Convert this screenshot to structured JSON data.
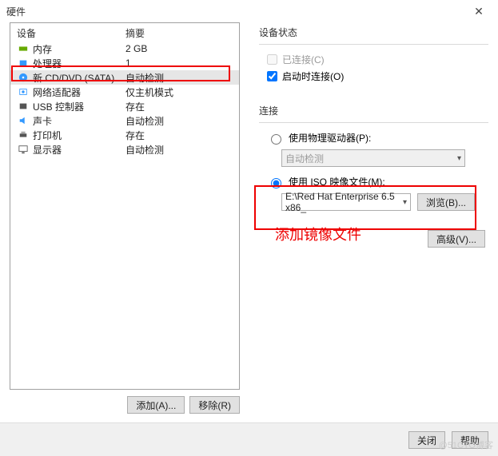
{
  "title": "硬件",
  "columns": {
    "device": "设备",
    "summary": "摘要"
  },
  "devices": [
    {
      "name": "内存",
      "summary": "2 GB",
      "icon": "memory"
    },
    {
      "name": "处理器",
      "summary": "1",
      "icon": "cpu"
    },
    {
      "name": "新 CD/DVD (SATA)",
      "summary": "自动检测",
      "icon": "disc",
      "selected": true
    },
    {
      "name": "网络适配器",
      "summary": "仅主机模式",
      "icon": "net"
    },
    {
      "name": "USB 控制器",
      "summary": "存在",
      "icon": "usb"
    },
    {
      "name": "声卡",
      "summary": "自动检测",
      "icon": "sound"
    },
    {
      "name": "打印机",
      "summary": "存在",
      "icon": "printer"
    },
    {
      "name": "显示器",
      "summary": "自动检测",
      "icon": "display"
    }
  ],
  "buttons": {
    "add": "添加(A)...",
    "remove": "移除(R)",
    "browse": "浏览(B)...",
    "advanced": "高级(V)...",
    "close": "关闭",
    "help": "帮助"
  },
  "status": {
    "title": "设备状态",
    "connected": "已连接(C)",
    "connect_on_start": "启动时连接(O)"
  },
  "connection": {
    "title": "连接",
    "physical": "使用物理驱动器(P):",
    "physical_value": "自动检测",
    "iso": "使用 ISO 映像文件(M):",
    "iso_value": "E:\\Red Hat Enterprise 6.5 x86_"
  },
  "annotation": "添加镜像文件",
  "watermark": "@51CTO博客"
}
